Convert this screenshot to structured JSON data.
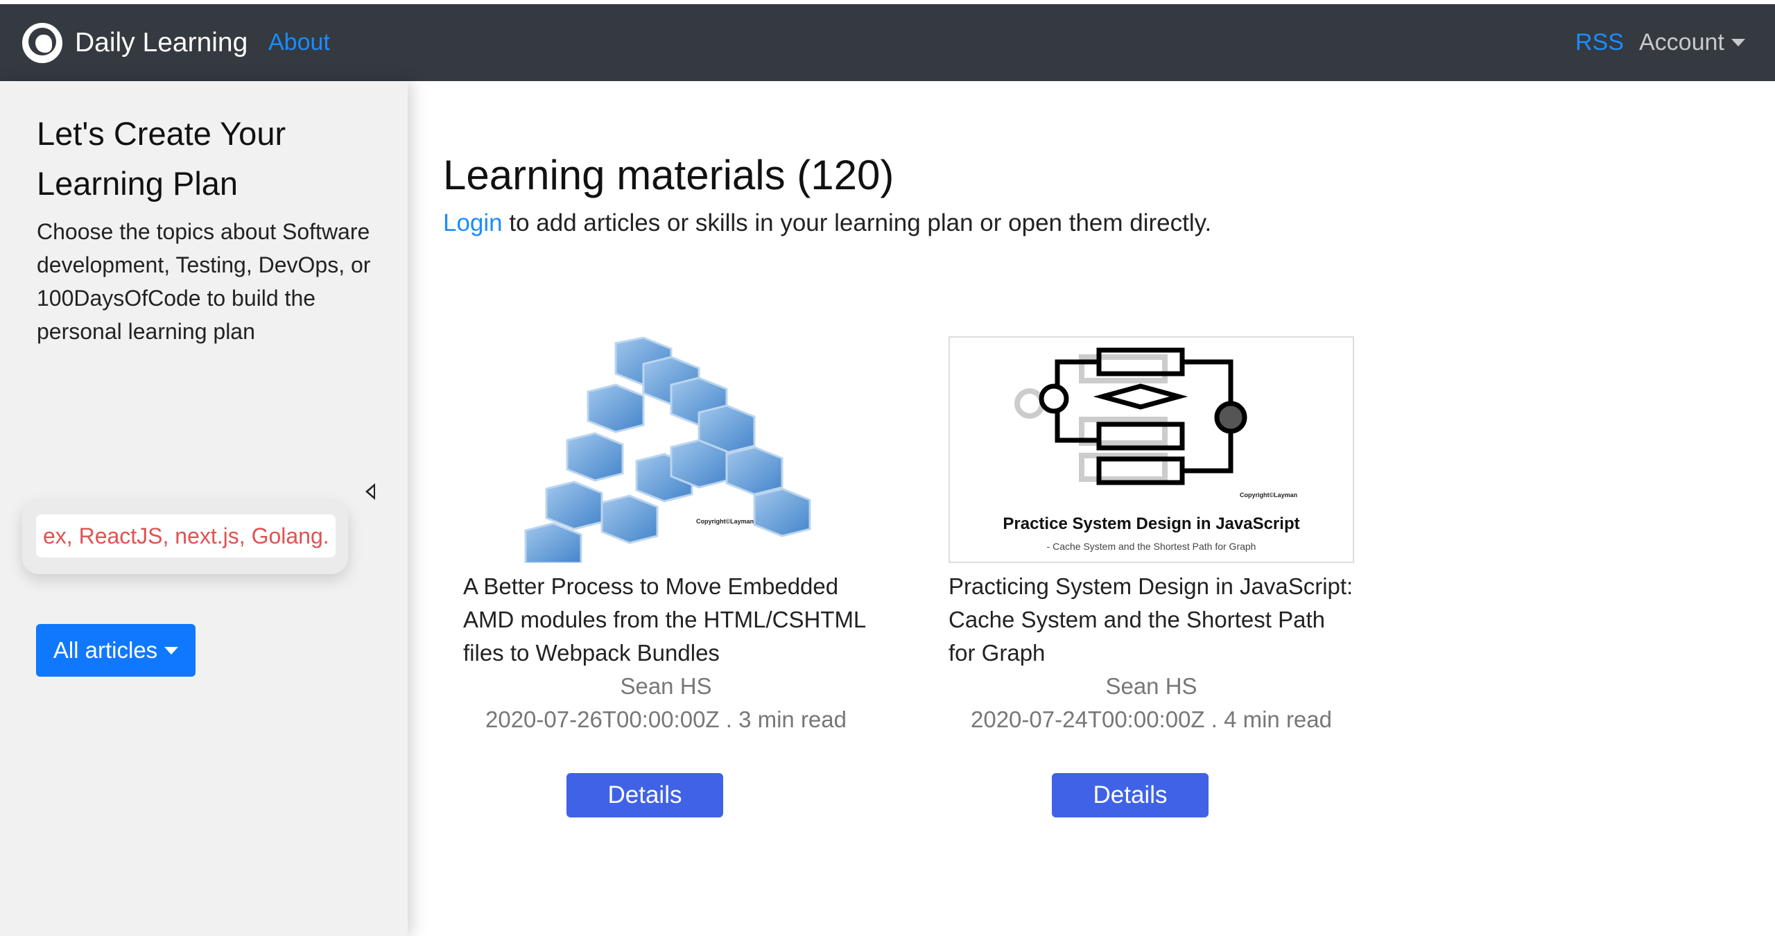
{
  "navbar": {
    "brand": "Daily Learning",
    "about": "About",
    "rss": "RSS",
    "account": "Account"
  },
  "sidebar": {
    "title": "Let's Create Your Learning Plan",
    "description": "Choose the topics about Software development, Testing, DevOps, or 100DaysOfCode to build the personal learning plan",
    "search_placeholder": "ex, ReactJS, next.js, Golang.",
    "filter_label": "All articles"
  },
  "main": {
    "heading": "Learning materials (120)",
    "login_link": "Login",
    "login_text": " to add articles or skills in your learning plan or open them directly."
  },
  "articles": [
    {
      "title": "A Better Process to Move Embedded AMD modules from the HTML/CSHTML files to Webpack Bundles",
      "author": "Sean HS",
      "meta": "2020-07-26T00:00:00Z . 3 min read",
      "button": "Details",
      "image_copyright": "Copyright©Layman"
    },
    {
      "title": "Practicing System Design in JavaScript: Cache System and the Shortest Path for Graph",
      "author": "Sean HS",
      "meta": "2020-07-24T00:00:00Z . 4 min read",
      "button": "Details",
      "image_title": "Practice System Design in JavaScript",
      "image_subtitle": "- Cache System and the Shortest Path for Graph",
      "image_copyright": "Copyright©Layman"
    }
  ],
  "colors": {
    "navbar_bg": "#343a40",
    "link": "#1a8cff",
    "primary_button": "#1078ff",
    "details_button": "#3f62e6",
    "placeholder": "#e05252"
  }
}
